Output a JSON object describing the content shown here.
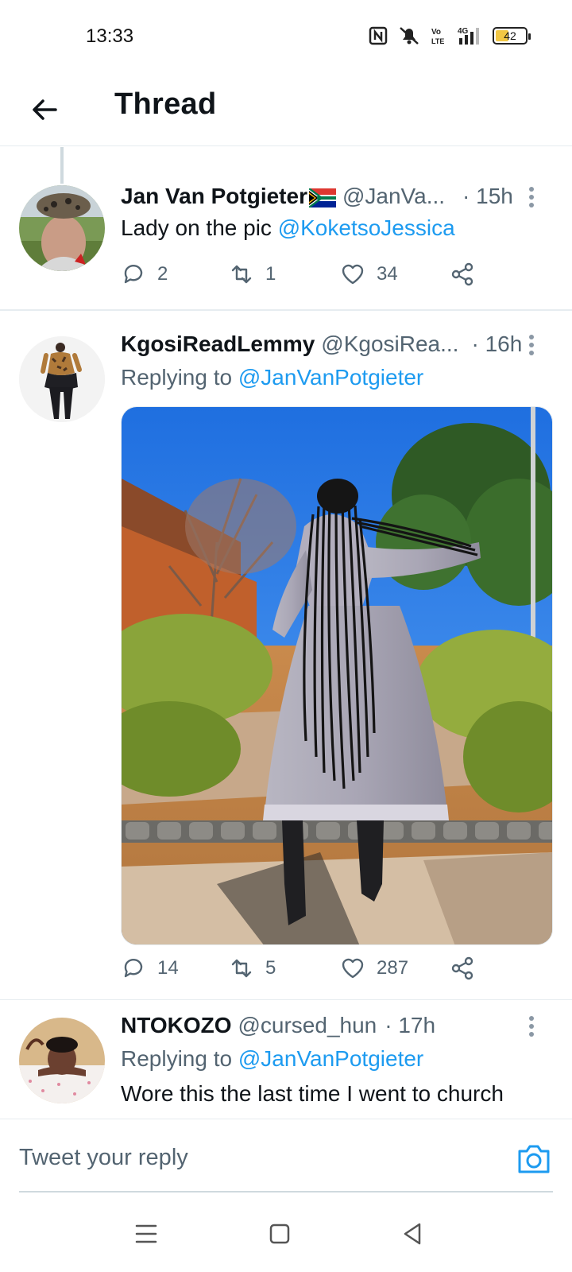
{
  "status": {
    "time": "13:33",
    "battery": "42",
    "icons": [
      "nfc-icon",
      "mute-icon",
      "volte-icon",
      "4g-signal-icon",
      "battery-icon"
    ]
  },
  "header": {
    "title": "Thread"
  },
  "tweets": [
    {
      "name": "Jan Van Potgieter",
      "flag": "🇿🇦",
      "handle": "@JanVa...",
      "time": "· 15h",
      "text": "Lady on the pic ",
      "mention": "@KoketsoJessica",
      "replies": "2",
      "retweets": "1",
      "likes": "34"
    },
    {
      "name": "KgosiReadLemmy",
      "handle": "@KgosiRea...",
      "time": "· 16h",
      "replying_prefix": "Replying to ",
      "replying_to": "@JanVanPotgieter",
      "replies": "14",
      "retweets": "5",
      "likes": "287"
    },
    {
      "name": "NTOKOZO",
      "handle": "@cursed_hun",
      "time": "· 17h",
      "replying_prefix": "Replying to ",
      "replying_to": "@JanVanPotgieter",
      "text": "Wore this the last time I went to church"
    }
  ],
  "reply_bar": {
    "placeholder": "Tweet your reply"
  },
  "colors": {
    "accent": "#1d9bf0",
    "secondary_text": "#536471",
    "divider": "#e6ecf0"
  }
}
